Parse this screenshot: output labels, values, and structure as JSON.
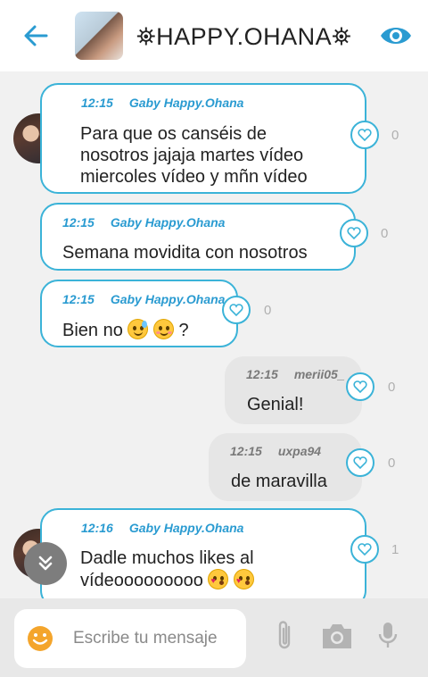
{
  "header": {
    "title": "⛯HAPPY.OHANA⛯",
    "back_icon": "arrow-left-icon",
    "view_icon": "eye-icon",
    "accent": "#2a9bd1"
  },
  "messages": [
    {
      "direction": "incoming",
      "time": "12:15",
      "author": "Gaby Happy.Ohana",
      "lines": [
        "Para que os canséis de",
        "nosotros jajaja martes vídeo",
        "miercoles vídeo y mñn vídeo"
      ],
      "likes": "0",
      "avatar": true
    },
    {
      "direction": "incoming",
      "time": "12:15",
      "author": "Gaby Happy.Ohana",
      "lines": [
        "Semana movidita con nosotros"
      ],
      "likes": "0",
      "avatar": false
    },
    {
      "direction": "incoming",
      "time": "12:15",
      "author": "Gaby Happy.Ohana",
      "text_before": "Bien no",
      "text_after": "?",
      "emojis": [
        "sweat-smile-emoji",
        "blush-smile-emoji"
      ],
      "likes": "0",
      "avatar": false
    },
    {
      "direction": "outgoing",
      "time": "12:15",
      "author": "merii05_",
      "lines": [
        "Genial!"
      ],
      "likes": "0"
    },
    {
      "direction": "outgoing",
      "time": "12:15",
      "author": "uxpa94",
      "lines": [
        "de maravilla"
      ],
      "likes": "0"
    },
    {
      "direction": "incoming",
      "time": "12:16",
      "author": "Gaby Happy.Ohana",
      "line1": "Dadle muchos likes al",
      "line2": "vídeooooooooo",
      "emojis": [
        "kiss-heart-emoji",
        "kiss-heart-emoji"
      ],
      "likes": "1",
      "avatar": true
    }
  ],
  "scroll_down_icon": "double-chevron-down-icon",
  "composer": {
    "placeholder": "Escribe tu mensaje",
    "emoji_icon": "smile-icon",
    "attach_icon": "paperclip-icon",
    "camera_icon": "camera-icon",
    "mic_icon": "microphone-icon"
  }
}
